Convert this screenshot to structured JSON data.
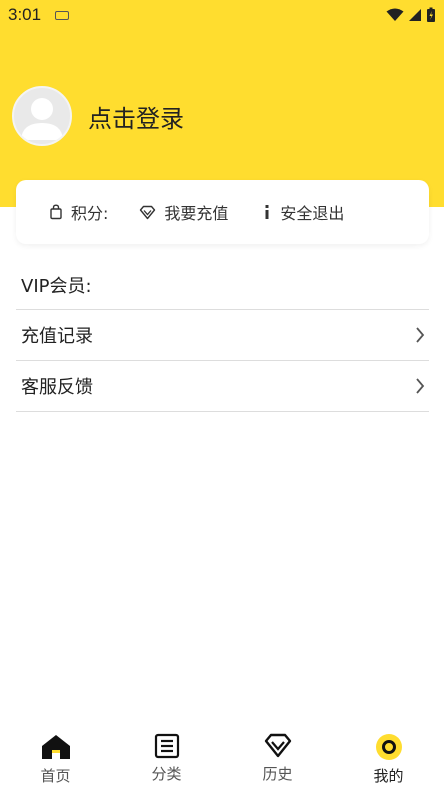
{
  "status_bar": {
    "time": "3:01"
  },
  "profile": {
    "login_text": "点击登录"
  },
  "card": {
    "points_label": "积分:",
    "recharge_label": "我要充值",
    "logout_label": "安全退出"
  },
  "list": {
    "vip_label": "VIP会员:",
    "recharge_record_label": "充值记录",
    "feedback_label": "客服反馈"
  },
  "bottom_nav": {
    "items": [
      {
        "label": "首页",
        "icon": "home-icon"
      },
      {
        "label": "分类",
        "icon": "category-icon"
      },
      {
        "label": "历史",
        "icon": "diamond-icon"
      },
      {
        "label": "我的",
        "icon": "profile-ring-icon"
      }
    ],
    "active_index": 3
  },
  "colors": {
    "accent": "#ffdd2f",
    "divider": "#dddddd"
  }
}
